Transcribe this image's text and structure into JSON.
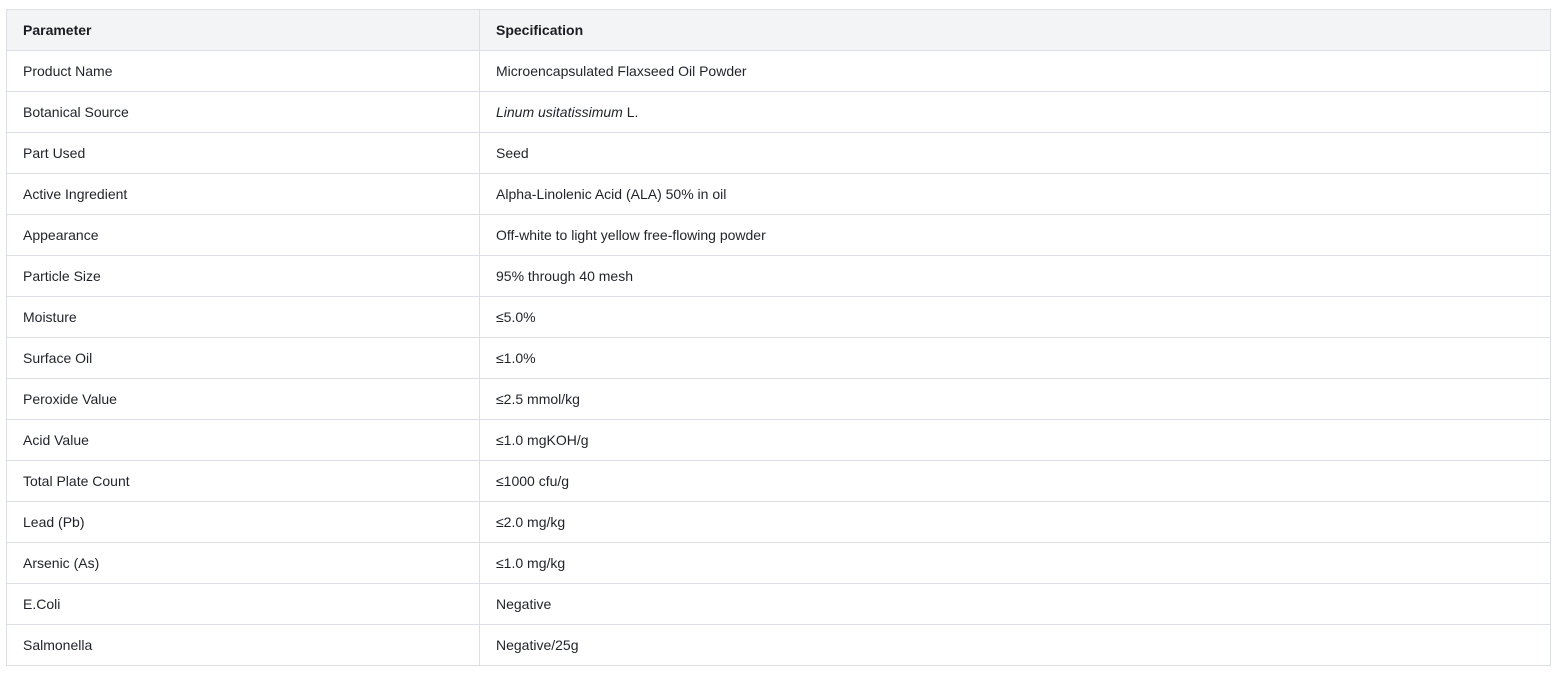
{
  "table": {
    "headers": [
      "Parameter",
      "Specification"
    ],
    "rows": [
      {
        "parameter": "Product Name",
        "spec": "Microencapsulated Flaxseed Oil Powder"
      },
      {
        "parameter": "Botanical Source",
        "spec_italic": "Linum usitatissimum",
        "spec": " L."
      },
      {
        "parameter": "Part Used",
        "spec": "Seed"
      },
      {
        "parameter": "Active Ingredient",
        "spec": "Alpha-Linolenic Acid (ALA) 50% in oil"
      },
      {
        "parameter": "Appearance",
        "spec": "Off-white to light yellow free-flowing powder"
      },
      {
        "parameter": "Particle Size",
        "spec": "95% through 40 mesh"
      },
      {
        "parameter": "Moisture",
        "spec": "≤5.0%"
      },
      {
        "parameter": "Surface Oil",
        "spec": "≤1.0%"
      },
      {
        "parameter": "Peroxide Value",
        "spec": "≤2.5 mmol/kg"
      },
      {
        "parameter": "Acid Value",
        "spec": "≤1.0 mgKOH/g"
      },
      {
        "parameter": "Total Plate Count",
        "spec": "≤1000 cfu/g"
      },
      {
        "parameter": "Lead (Pb)",
        "spec": "≤2.0 mg/kg"
      },
      {
        "parameter": "Arsenic (As)",
        "spec": "≤1.0 mg/kg"
      },
      {
        "parameter": "E.Coli",
        "spec": "Negative"
      },
      {
        "parameter": "Salmonella",
        "spec": "Negative/25g"
      }
    ]
  }
}
